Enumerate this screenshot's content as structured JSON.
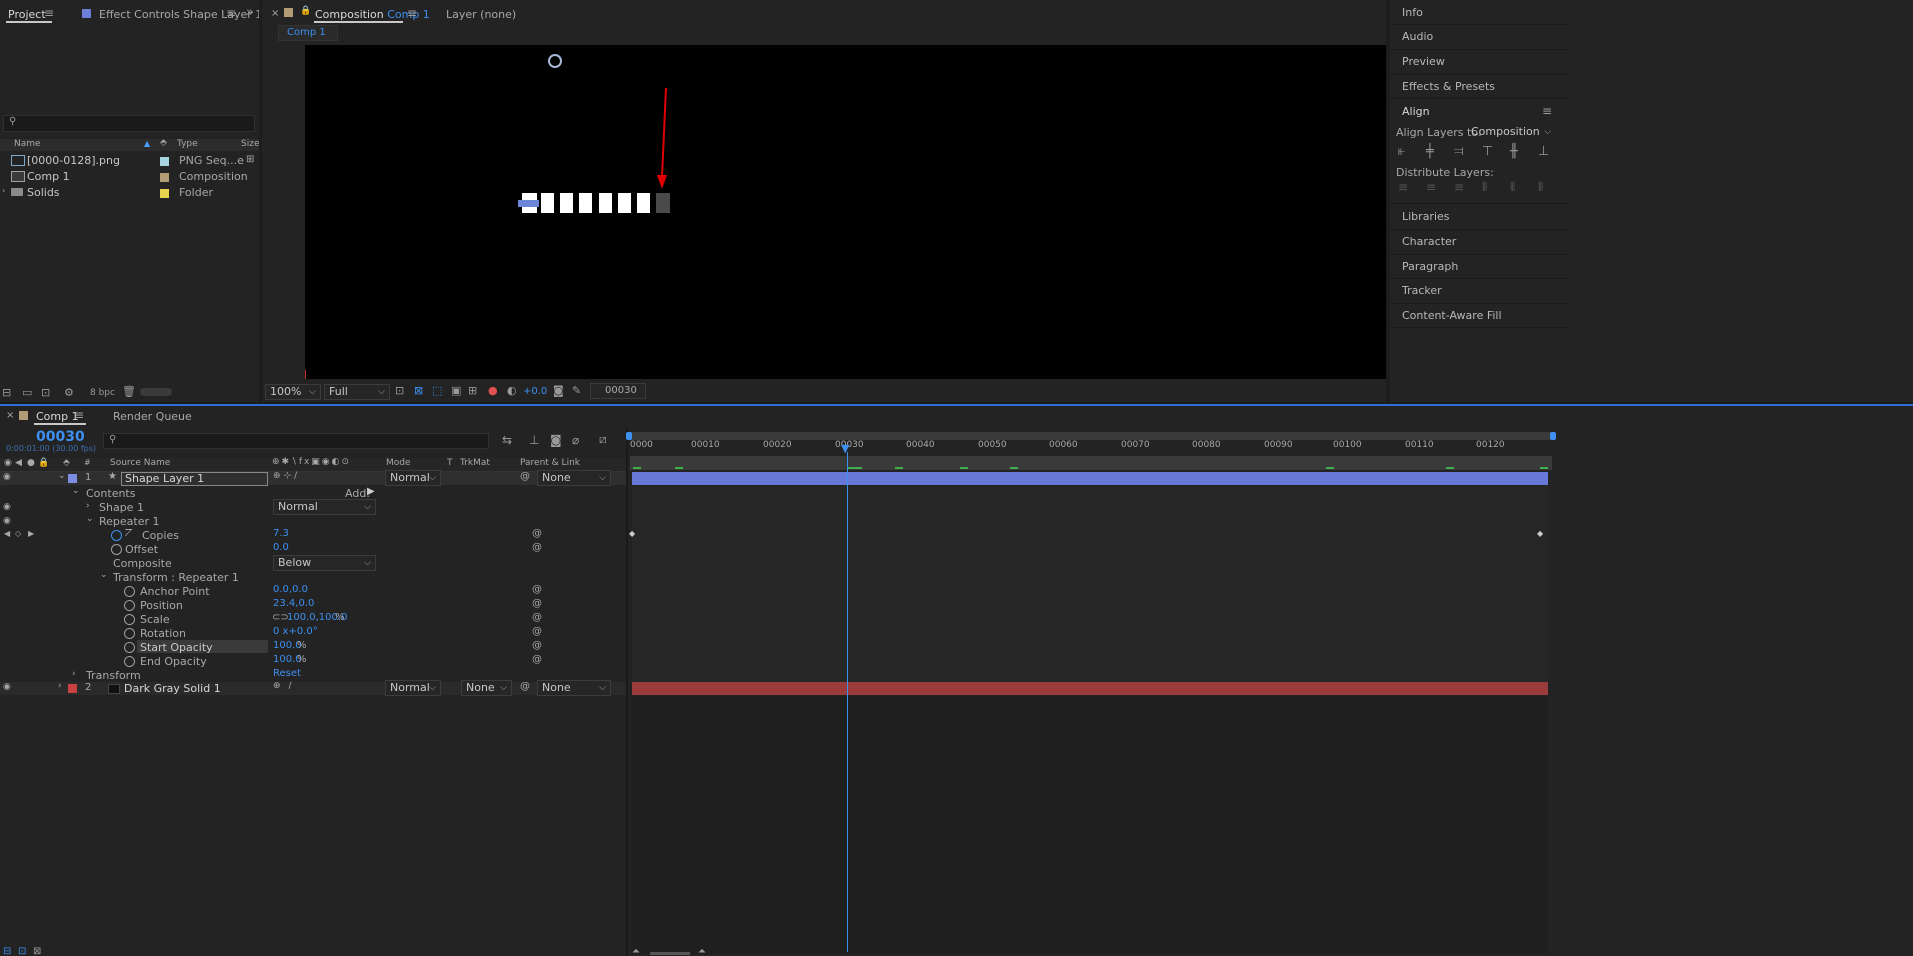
{
  "project_panel": {
    "tabs": [
      {
        "label": "Project"
      },
      {
        "label": "Effect Controls",
        "suffix": "Shape Layer 1"
      }
    ],
    "search_placeholder": "",
    "columns": [
      "Name",
      "Type",
      "Size"
    ],
    "items": [
      {
        "name": "[0000-0128].png",
        "type": "PNG Seq...e",
        "color": "#a6d4e0"
      },
      {
        "name": "Comp 1",
        "type": "Composition",
        "color": "#b39b75"
      },
      {
        "name": "Solids",
        "type": "Folder",
        "color": "#e8d44d"
      }
    ],
    "bpc_label": "8 bpc"
  },
  "composition_panel": {
    "tab_label": "Composition",
    "tab_comp": "Comp 1",
    "layer_tab": "Layer (none)",
    "breadcrumb": "Comp 1",
    "zoom": "100%",
    "resolution": "Full",
    "exposure": "+0.0",
    "timecode": "00030"
  },
  "right_panels": {
    "items_top": [
      "Info",
      "Audio",
      "Preview",
      "Effects & Presets"
    ],
    "align": {
      "title": "Align",
      "align_to_label": "Align Layers to:",
      "align_to_value": "Composition",
      "distribute_label": "Distribute Layers:"
    },
    "items_bottom": [
      "Libraries",
      "Character",
      "Paragraph",
      "Tracker",
      "Content-Aware Fill"
    ]
  },
  "timeline": {
    "tab_label": "Comp 1",
    "render_queue": "Render Queue",
    "current_time": "00030",
    "time_sub": "0:00:01:00 (30.00 fps)",
    "search_placeholder": "",
    "headers": {
      "source_name": "Source Name",
      "mode": "Mode",
      "t": "T",
      "trkmat": "TrkMat",
      "parent": "Parent & Link"
    },
    "ruler": [
      "0000",
      "00010",
      "00020",
      "00030",
      "00040",
      "00050",
      "00060",
      "00070",
      "00080",
      "00090",
      "00100",
      "00110",
      "00120"
    ],
    "layer1": {
      "num": "1",
      "name": "Shape Layer 1",
      "mode": "Normal",
      "parent": "None",
      "color": "#7b8de0"
    },
    "contents": {
      "label": "Contents",
      "add": "Add:"
    },
    "shape1": {
      "label": "Shape 1",
      "mode": "Normal"
    },
    "repeater": {
      "label": "Repeater 1"
    },
    "copies": {
      "label": "Copies",
      "value": "7.3"
    },
    "offset": {
      "label": "Offset",
      "value": "0.0"
    },
    "composite": {
      "label": "Composite",
      "value": "Below"
    },
    "transform_repeater": {
      "label": "Transform : Repeater 1"
    },
    "anchor": {
      "label": "Anchor Point",
      "value": "0.0,0.0"
    },
    "position": {
      "label": "Position",
      "value": "23.4,0.0"
    },
    "scale": {
      "label": "Scale",
      "value": "100.0,100.0",
      "unit": "%"
    },
    "rotation": {
      "label": "Rotation",
      "value": "0 x+0.0°"
    },
    "start_opacity": {
      "label": "Start Opacity",
      "value": "100.0",
      "unit": "%"
    },
    "end_opacity": {
      "label": "End Opacity",
      "value": "100.0",
      "unit": "%"
    },
    "transform": {
      "label": "Transform",
      "value": "Reset"
    },
    "layer2": {
      "num": "2",
      "name": "Dark Gray Solid 1",
      "mode": "Normal",
      "trkmat": "None",
      "parent": "None",
      "color": "#c84040"
    }
  }
}
